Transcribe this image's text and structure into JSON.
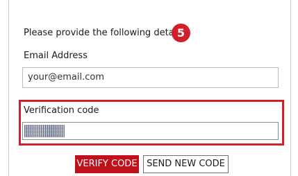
{
  "form": {
    "intro_text": "Please provide the following details.",
    "step_number": "5",
    "email_label": "Email Address",
    "email_placeholder": "your@email.com",
    "verification_label": "Verification code",
    "verification_value": ""
  },
  "buttons": {
    "verify_label": "VERIFY CODE",
    "send_new_label": "SEND NEW CODE"
  },
  "colors": {
    "accent": "#d1202a",
    "verify_button_bg": "#c0101c"
  }
}
